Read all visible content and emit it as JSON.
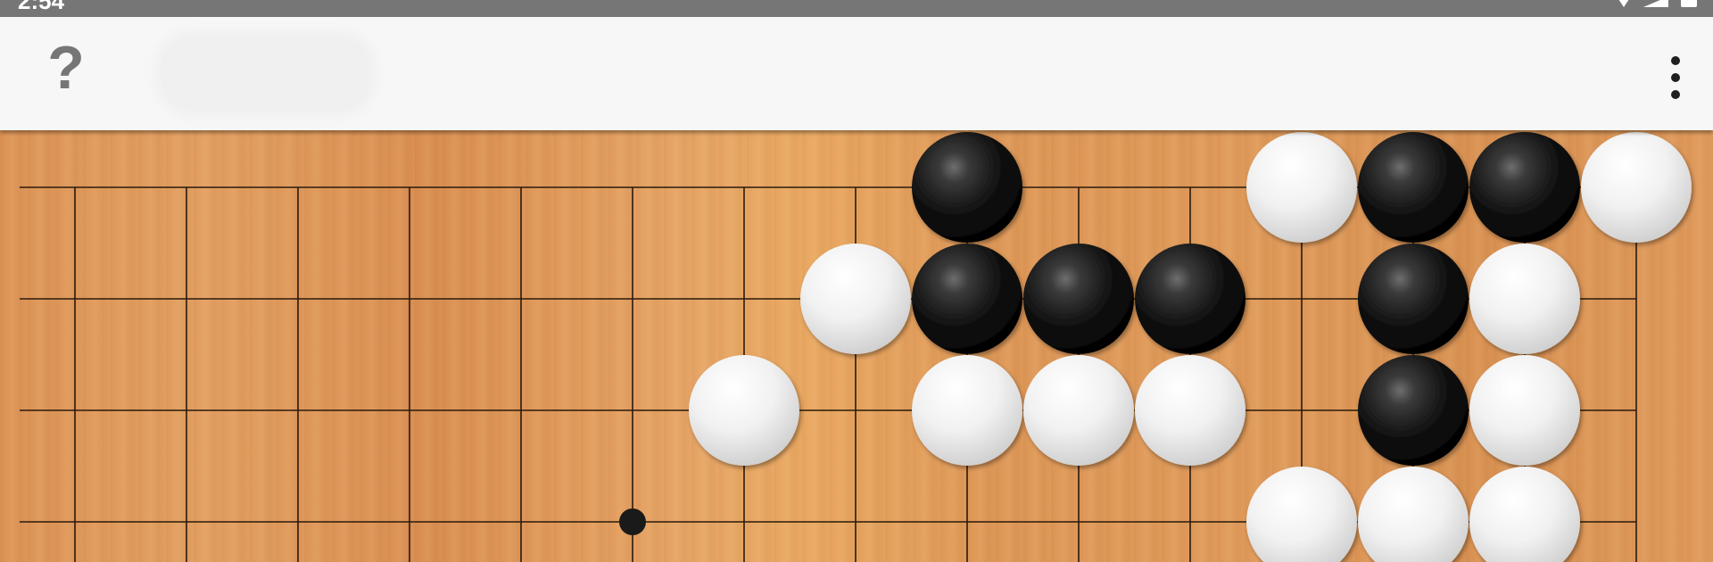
{
  "status_bar": {
    "time": "2:54",
    "icons": [
      "wifi-icon",
      "signal-icon",
      "battery-icon"
    ]
  },
  "toolbar": {
    "help_label": "?",
    "menu_icon": "more-vert-icon"
  },
  "colors": {
    "status_bar": "#767676",
    "app_bar": "#f7f7f7",
    "board_wood": "#e09a5c",
    "grid_line": "#2a1a0c",
    "black_stone": "#111111",
    "white_stone": "#f2f2f2"
  },
  "board": {
    "visible_columns": 15,
    "visible_rows": 4,
    "stones": [
      {
        "col": 8,
        "row": 0,
        "color": "black"
      },
      {
        "col": 11,
        "row": 0,
        "color": "white"
      },
      {
        "col": 12,
        "row": 0,
        "color": "black"
      },
      {
        "col": 13,
        "row": 0,
        "color": "black"
      },
      {
        "col": 14,
        "row": 0,
        "color": "white"
      },
      {
        "col": 7,
        "row": 1,
        "color": "white"
      },
      {
        "col": 8,
        "row": 1,
        "color": "black"
      },
      {
        "col": 9,
        "row": 1,
        "color": "black"
      },
      {
        "col": 10,
        "row": 1,
        "color": "black"
      },
      {
        "col": 12,
        "row": 1,
        "color": "black"
      },
      {
        "col": 13,
        "row": 1,
        "color": "white"
      },
      {
        "col": 6,
        "row": 2,
        "color": "white"
      },
      {
        "col": 8,
        "row": 2,
        "color": "white"
      },
      {
        "col": 9,
        "row": 2,
        "color": "white"
      },
      {
        "col": 10,
        "row": 2,
        "color": "white"
      },
      {
        "col": 12,
        "row": 2,
        "color": "black"
      },
      {
        "col": 13,
        "row": 2,
        "color": "white"
      },
      {
        "col": 11,
        "row": 3,
        "color": "white"
      },
      {
        "col": 12,
        "row": 3,
        "color": "white"
      },
      {
        "col": 13,
        "row": 3,
        "color": "white"
      }
    ],
    "star_points": [
      {
        "col": 5,
        "row": 3
      }
    ]
  }
}
